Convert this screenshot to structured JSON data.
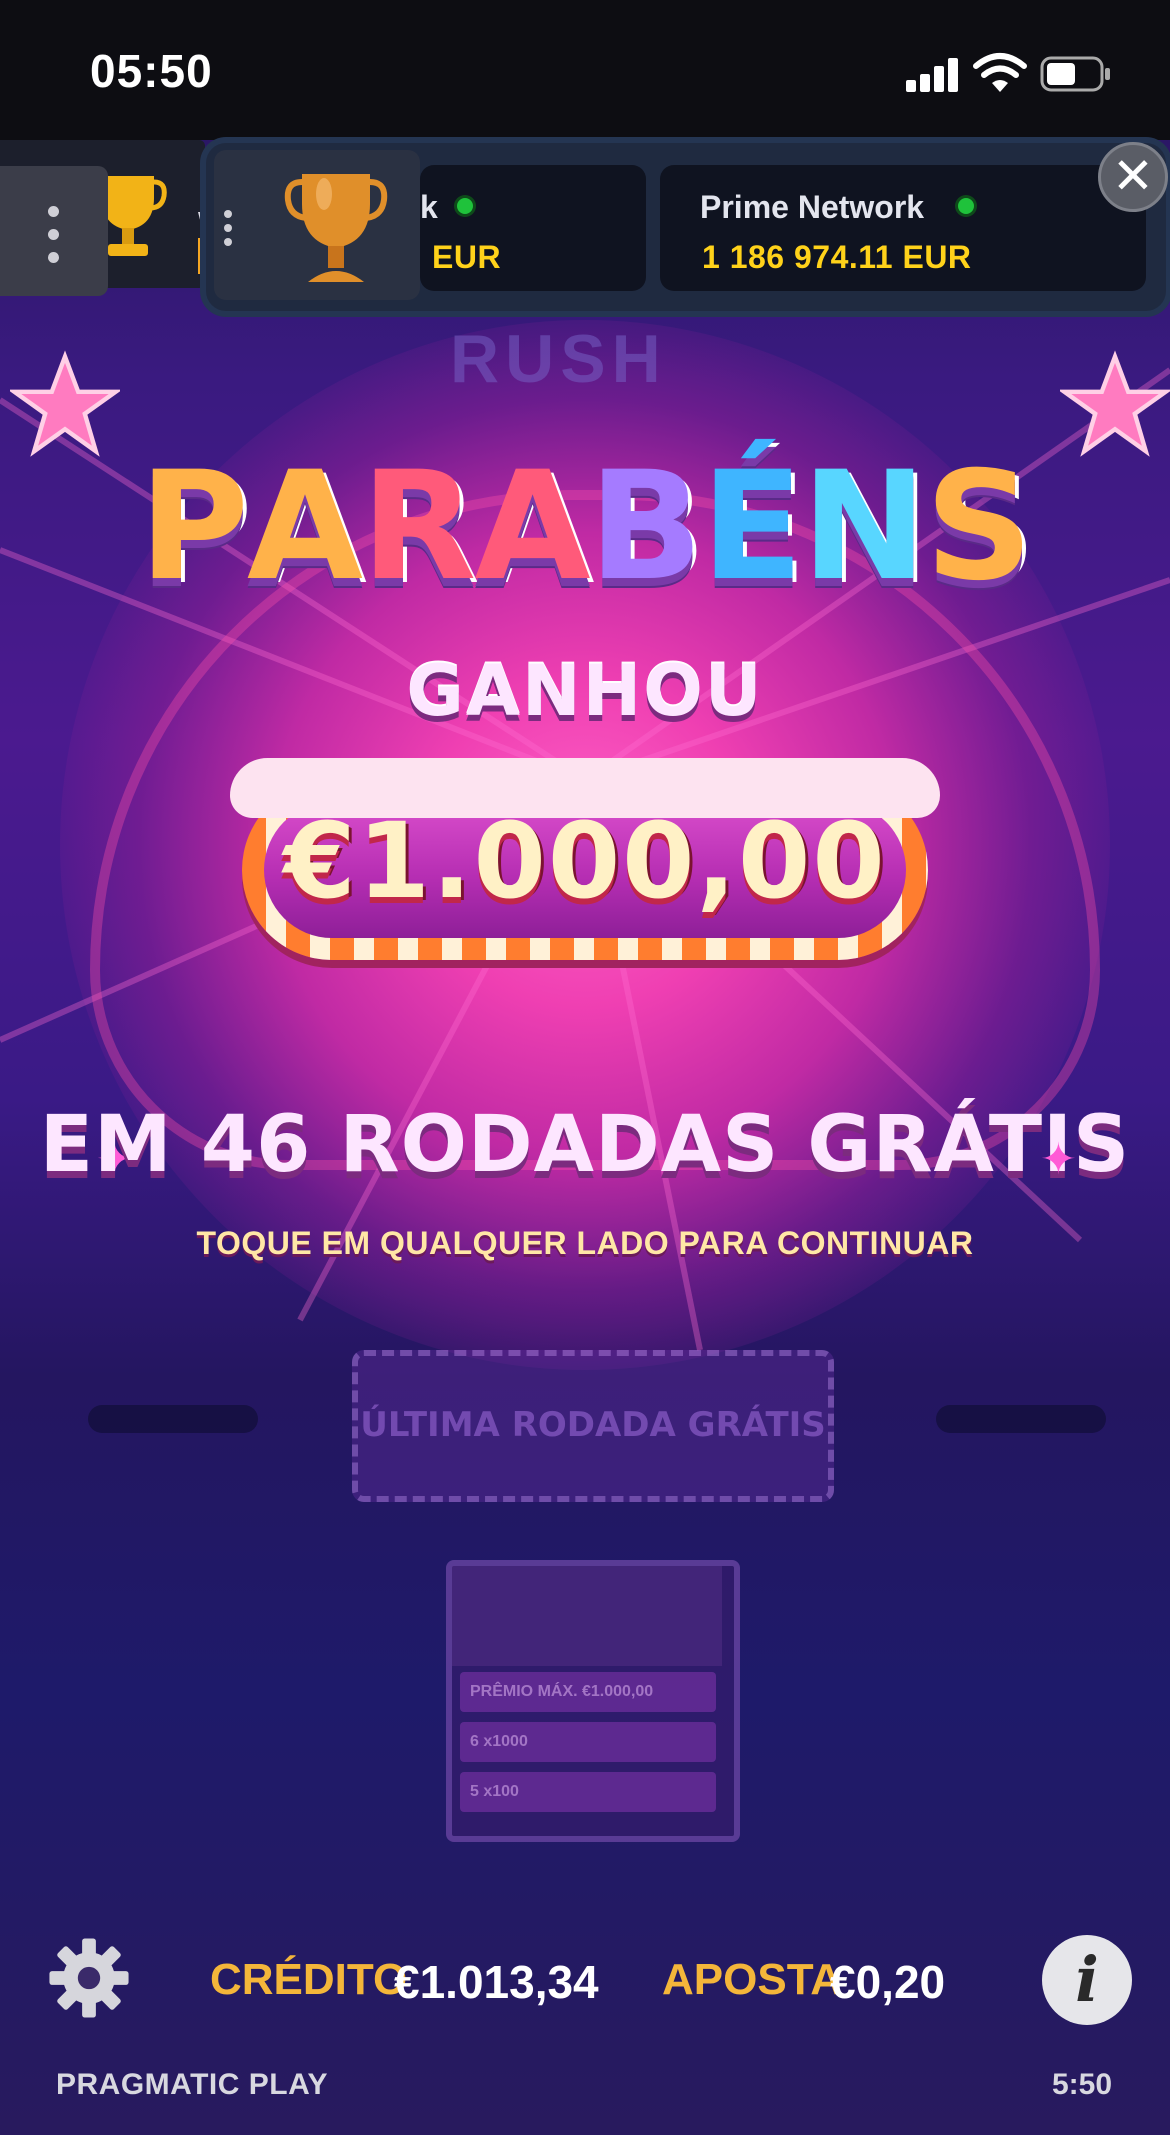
{
  "status_bar": {
    "time": "05:50"
  },
  "game": {
    "background_logo": "RUSH",
    "overlay": {
      "title": "PARABÉNS",
      "title_letters": [
        "P",
        "A",
        "R",
        "A",
        "B",
        "É",
        "N",
        "S"
      ],
      "title_colors": [
        "#ffb24a",
        "#ffb24a",
        "#ff5a7a",
        "#ff5a7a",
        "#a57bff",
        "#3fb5ff",
        "#58d6ff",
        "#ffb24a"
      ],
      "won_label": "GANHOU",
      "win_amount": "€1.000,00",
      "spins_label": "EM 46 RODADAS GRÁTIS",
      "continue_hint": "TOQUE EM QUALQUER LADO PARA CONTINUAR"
    },
    "background_panel": {
      "last_spin_label": "ÚLTIMA RODADA GRÁTIS",
      "paytable_rows": [
        "PRÊMIO MÁX. €1.000,00",
        "6  x1000",
        "5  x100"
      ]
    },
    "bottom_bar": {
      "credit_label": "CRÉDITO",
      "credit_value": "€1.013,34",
      "bet_label": "APOSTA",
      "bet_value": "€0,20",
      "info_symbol": "i",
      "provider": "PRAGMATIC PLAY",
      "clock": "5:50"
    }
  },
  "jackpot_widget": {
    "left_label": "W",
    "card_1": {
      "title": "k",
      "value": "EUR"
    },
    "card_2": {
      "title": "Prime Network",
      "value": "1 186 974.11 EUR"
    },
    "close_symbol": "✕"
  },
  "colors": {
    "accent_gold": "#f4b63a",
    "jackpot_yellow": "#ffd21a",
    "online_green": "#1fc23b",
    "overlay_pink": "#ef3fb2"
  },
  "icons": [
    "signal-icon",
    "wifi-icon",
    "battery-icon",
    "trophy-icon",
    "close-icon",
    "gear-icon",
    "info-icon",
    "star-icon",
    "sparkle-icon",
    "drag-handle-icon"
  ]
}
